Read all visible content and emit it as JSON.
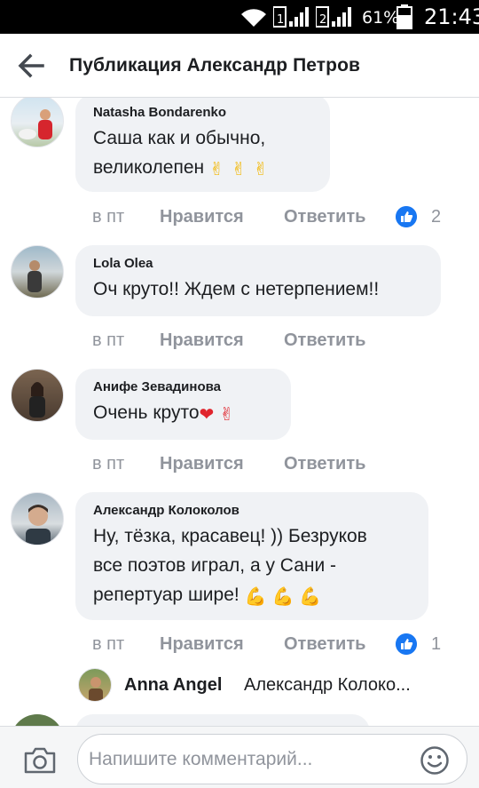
{
  "status_bar": {
    "battery_percent": "61%",
    "time": "21:43",
    "sim1": "1",
    "sim2": "2"
  },
  "header": {
    "title": "Публикация Александр Петров"
  },
  "comments": [
    {
      "author": "Natasha Bondarenko",
      "lines": [
        "Саша как и обычно,",
        "великолепен"
      ],
      "emoji_suffix": "✌✌✌",
      "time": "в пт",
      "like_label": "Нравится",
      "reply_label": "Ответить",
      "likes": "2"
    },
    {
      "author": "Lola Olea",
      "lines": [
        "Оч круто!! Ждем с нетерпением!!"
      ],
      "time": "в пт",
      "like_label": "Нравится",
      "reply_label": "Ответить"
    },
    {
      "author": "Анифе Зевадинова",
      "lines": [
        "Очень круто"
      ],
      "emoji_suffix": "❤✌",
      "time": "в пт",
      "like_label": "Нравится",
      "reply_label": "Ответить"
    },
    {
      "author": "Александр Колоколов",
      "lines": [
        "Ну, тёзка, красавец! )) Безруков",
        "все поэтов играл, а у Сани -",
        "репертуар шире!"
      ],
      "emoji_suffix": "💪💪💪",
      "time": "в пт",
      "like_label": "Нравится",
      "reply_label": "Ответить",
      "likes": "1"
    }
  ],
  "reply_preview": {
    "author": "Anna Angel",
    "snippet": "Александр Колоко..."
  },
  "composer": {
    "placeholder": "Напишите комментарий..."
  },
  "icons": {
    "back": "arrow-left-icon",
    "camera": "camera-icon",
    "smiley": "smiley-icon",
    "like_badge": "thumbs-up-icon"
  },
  "colors": {
    "accent": "#1877f2",
    "bubble": "#f0f2f5",
    "meta_text": "#90949c"
  }
}
